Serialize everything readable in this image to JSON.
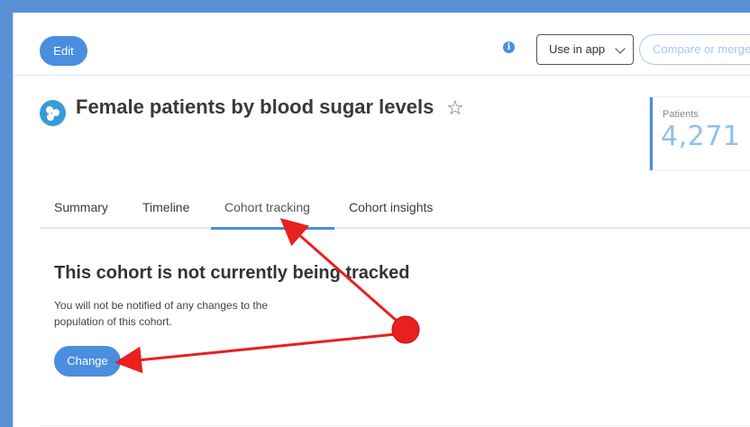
{
  "toolbar": {
    "edit_label": "Edit",
    "info_icon": "info-icon",
    "use_in_app_label": "Use in app",
    "compare_label": "Compare or merge"
  },
  "header": {
    "title": "Female patients by blood sugar levels",
    "patients_label": "Patients",
    "patients_count": "4,271"
  },
  "tabs": [
    {
      "label": "Summary",
      "active": false
    },
    {
      "label": "Timeline",
      "active": false
    },
    {
      "label": "Cohort tracking",
      "active": true
    },
    {
      "label": "Cohort insights",
      "active": false
    }
  ],
  "tracking": {
    "title": "This cohort is not currently being tracked",
    "description": "You will not be notified of any changes to the population of this cohort.",
    "change_label": "Change"
  },
  "colors": {
    "accent": "#4a8ee0",
    "frame": "#5b8fd8",
    "annotation_red": "#e8201e"
  }
}
